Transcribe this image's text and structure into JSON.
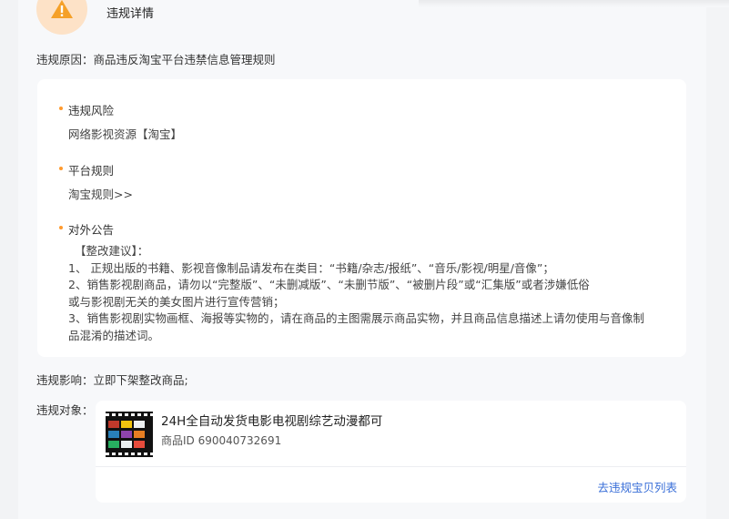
{
  "header": {
    "title": "违规详情",
    "icon": "warning-icon",
    "icon_color": "#f5a028",
    "icon_bg": "#fde2c7"
  },
  "reason": {
    "label": "违规原因：",
    "text": "商品违反淘宝平台违禁信息管理规则"
  },
  "sections": [
    {
      "title": "违规风险",
      "body": "网络影视资源【淘宝】"
    },
    {
      "title": "平台规则",
      "body": "淘宝规则>>"
    },
    {
      "title": "对外公告",
      "lines": [
        "【整改建议】：",
        "1、 正规出版的书籍、影视音像制品请发布在类目：“书籍/杂志/报纸”、“音乐/影视/明星/音像”；",
        "2、销售影视剧商品，请勿以“完整版”、“未删减版”、“未删节版”、“被删片段”或“汇集版”或者涉嫌低俗",
        "或与影视剧无关的美女图片进行宣传营销；",
        "3、销售影视剧实物画框、海报等实物的，请在商品的主图需展示商品实物，并且商品信息描述上请勿使用与音像制",
        "品混淆的描述词。"
      ]
    }
  ],
  "impact": {
    "label": "违规影响：",
    "text": "立即下架整改商品;"
  },
  "object": {
    "label": "违规对象：",
    "product_title": "24H全自动发货电影电视剧综艺动漫都可",
    "product_id": "商品ID 690040732691",
    "link": "去违规宝贝列表"
  },
  "colors": {
    "accent_dot": "#ff9a2e",
    "link": "#3a6fd8"
  }
}
